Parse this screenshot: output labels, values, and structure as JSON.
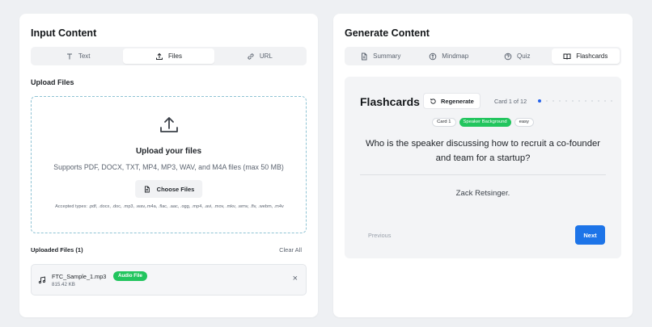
{
  "input_panel": {
    "title": "Input Content",
    "tabs": [
      {
        "label": "Text",
        "icon": "text-icon",
        "active": false
      },
      {
        "label": "Files",
        "icon": "upload-icon",
        "active": true
      },
      {
        "label": "URL",
        "icon": "link-icon",
        "active": false
      }
    ],
    "upload_section_label": "Upload Files",
    "dropzone": {
      "title": "Upload your files",
      "subtitle": "Supports PDF, DOCX, TXT, MP4, MP3, WAV, and M4A files (max 50 MB)",
      "button_label": "Choose Files",
      "accepted_types": "Accepted types: .pdf, .docx, .doc, .mp3, .wav,.m4a, .flac, .aac, .ogg, .mp4, .avi, .mov, .mkv, .wmv, .flv, .webm, .m4v"
    },
    "uploaded_label": "Uploaded Files (1)",
    "clear_all_label": "Clear All",
    "files": [
      {
        "name": "FTC_Sample_1.mp3",
        "badge": "Audio File",
        "size": "815.42 KB",
        "icon": "music-note-icon"
      }
    ]
  },
  "generate_panel": {
    "title": "Generate Content",
    "tabs": [
      {
        "label": "Summary",
        "icon": "document-icon",
        "active": false
      },
      {
        "label": "Mindmap",
        "icon": "mindmap-icon",
        "active": false
      },
      {
        "label": "Quiz",
        "icon": "question-icon",
        "active": false
      },
      {
        "label": "Flashcards",
        "icon": "book-icon",
        "active": true
      }
    ],
    "flashcards": {
      "heading": "Flashcards",
      "regenerate_label": "Regenerate",
      "counter": "Card 1 of 12",
      "total_cards": 12,
      "current_card": 1,
      "tags": [
        {
          "label": "Card 1",
          "style": "outline"
        },
        {
          "label": "Speaker Background",
          "style": "green"
        },
        {
          "label": "easy",
          "style": "outline"
        }
      ],
      "question": "Who is the speaker discussing how to recruit a co-founder and team for a startup?",
      "answer": "Zack Retsinger.",
      "previous_label": "Previous",
      "next_label": "Next"
    }
  },
  "colors": {
    "accent": "#1d74e8",
    "success": "#22c55e",
    "dot_active": "#2563eb"
  }
}
